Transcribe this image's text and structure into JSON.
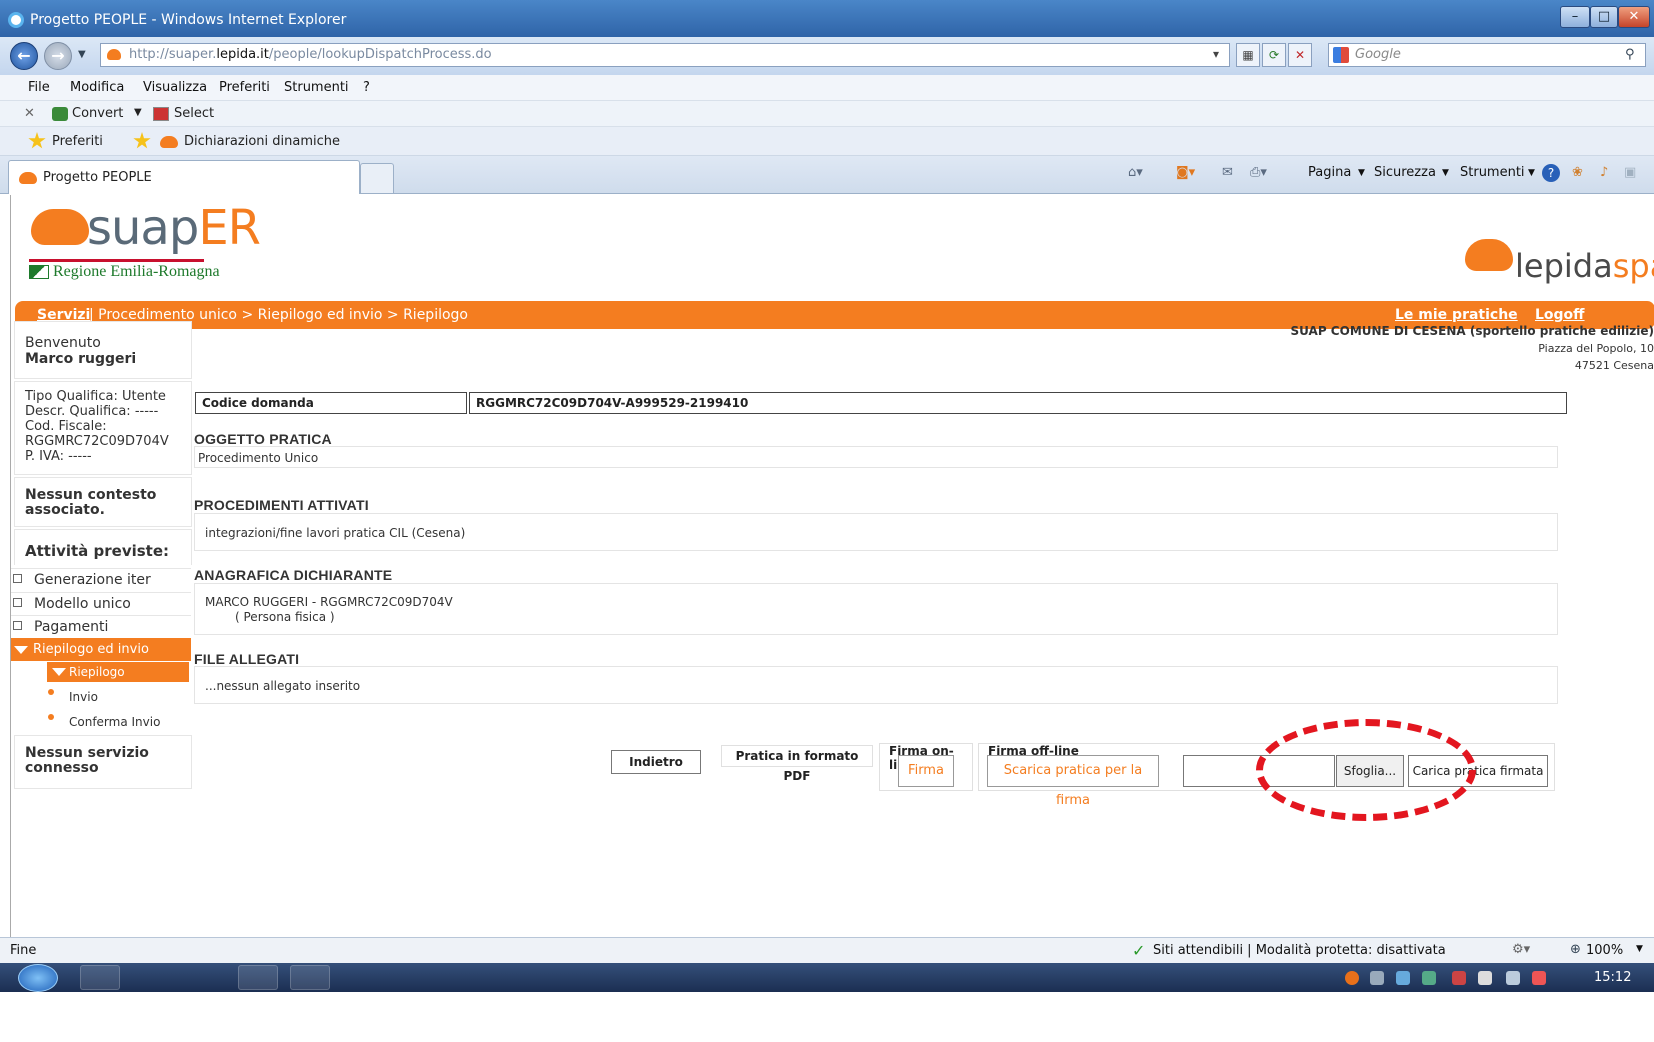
{
  "browser": {
    "title": "Progetto PEOPLE - Windows Internet Explorer",
    "url_prefix": "http://suaper.",
    "url_domain": "lepida.it",
    "url_path": "/people/lookupDispatchProcess.do",
    "search_placeholder": "Google",
    "menu": [
      "File",
      "Modifica",
      "Visualizza",
      "Preferiti",
      "Strumenti",
      "?"
    ],
    "command_convert": "Convert",
    "command_select": "Select",
    "favorites_label": "Preferiti",
    "favorite_link": "Dichiarazioni dinamiche",
    "tab_title": "Progetto PEOPLE",
    "tools": [
      "Pagina",
      "Sicurezza",
      "Strumenti"
    ]
  },
  "header": {
    "logo_suap": "suap",
    "logo_er": "ER",
    "region": "Regione Emilia-Romagna",
    "lepida_1": "lepida",
    "lepida_2": "spa"
  },
  "nav": {
    "servizi": "Servizi",
    "crumbs": " | Procedimento unico > Riepilogo ed invio > Riepilogo",
    "mie_pratiche": "Le mie pratiche",
    "logoff": "Logoff"
  },
  "sidebar": {
    "welcome": "Benvenuto",
    "user": "Marco ruggeri",
    "tipo": "Tipo Qualifica: Utente",
    "descr": "Descr. Qualifica: -----",
    "codfisc_label": "Cod. Fiscale:",
    "codfisc": "RGGMRC72C09D704V",
    "piva": "P. IVA: -----",
    "contesto": "Nessun contesto associato.",
    "attivita": "Attività previste:",
    "items": [
      "Generazione iter",
      "Modello unico",
      "Pagamenti",
      "Riepilogo ed invio"
    ],
    "sub_active": "Riepilogo",
    "sub_items": [
      "Invio",
      "Conferma Invio"
    ],
    "servizio": "Nessun servizio connesso"
  },
  "office": {
    "name": "SUAP COMUNE DI CESENA (sportello pratiche edilizie)",
    "address": "Piazza del Popolo, 10",
    "city": "47521 Cesena"
  },
  "main": {
    "codice_label": "Codice domanda",
    "codice_value": "RGGMRC72C09D704V-A999529-2199410",
    "oggetto_h": "OGGETTO PRATICA",
    "oggetto": "Procedimento Unico",
    "proc_h": "PROCEDIMENTI ATTIVATI",
    "proc": "integrazioni/fine lavori pratica CIL (Cesena)",
    "anag_h": "ANAGRAFICA DICHIARANTE",
    "anag_1": "MARCO RUGGERI - RGGMRC72C09D704V",
    "anag_2": "( Persona fisica )",
    "file_h": "FILE ALLEGATI",
    "file": "...nessun allegato inserito"
  },
  "actions": {
    "indietro": "Indietro",
    "pdf": "Pratica in formato PDF",
    "firma_online_label": "Firma on-line",
    "firma": "Firma",
    "firma_offline_label": "Firma off-line",
    "scarica": "Scarica pratica per la firma",
    "sfoglia": "Sfoglia...",
    "carica": "Carica pratica firmata"
  },
  "status": {
    "left": "Fine",
    "zone": "Siti attendibili | Modalità protetta: disattivata",
    "zoom": "100%",
    "clock": "15:12"
  }
}
